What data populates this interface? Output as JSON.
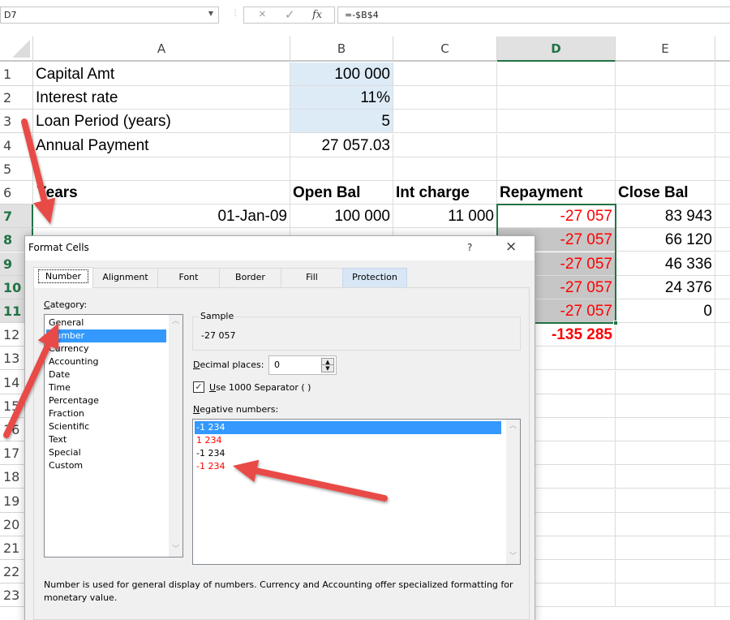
{
  "formula_bar": {
    "name_box": "D7",
    "cancel_icon": "×",
    "enter_icon": "✓",
    "fx_label": "fx",
    "formula": "=-$B$4"
  },
  "sheet": {
    "columns": [
      "A",
      "B",
      "C",
      "D",
      "E"
    ],
    "selected_column": "D",
    "row_numbers": [
      "1",
      "2",
      "3",
      "4",
      "5",
      "6",
      "7",
      "8",
      "9",
      "10",
      "11",
      "12",
      "13",
      "14",
      "15",
      "16",
      "17",
      "18",
      "19",
      "20",
      "21",
      "22",
      "23"
    ],
    "rows": [
      {
        "A": "Capital Amt",
        "B": "100 000"
      },
      {
        "A": "Interest rate",
        "B": "11%"
      },
      {
        "A": "Loan Period (years)",
        "B": "5"
      },
      {
        "A": "Annual Payment",
        "B": "27 057.03"
      },
      {},
      {
        "A": "Years",
        "B": "Open Bal",
        "C": "Int charge",
        "D": "Repayment",
        "E": "Close Bal"
      },
      {
        "A": "01-Jan-09",
        "B": "100 000",
        "C": "11 000",
        "D": "-27 057",
        "E": "83 943"
      },
      {
        "D": "-27 057",
        "E": "66 120"
      },
      {
        "D": "-27 057",
        "E": "46 336"
      },
      {
        "D": "-27 057",
        "E": "24 376"
      },
      {
        "D": "-27 057",
        "E": "0"
      },
      {
        "D": "-135 285"
      }
    ],
    "colors": {
      "negative": "#ff0000",
      "input_fill": "#ddebf7",
      "selection": "#217346"
    }
  },
  "dialog": {
    "title": "Format Cells",
    "help_label": "?",
    "close_label": "×",
    "tabs": [
      "Number",
      "Alignment",
      "Font",
      "Border",
      "Fill",
      "Protection"
    ],
    "active_tab": "Number",
    "category_label": "Category:",
    "categories": [
      "General",
      "Number",
      "Currency",
      "Accounting",
      "Date",
      "Time",
      "Percentage",
      "Fraction",
      "Scientific",
      "Text",
      "Special",
      "Custom"
    ],
    "selected_category": "Number",
    "sample_label": "Sample",
    "sample_value": "-27 057",
    "decimal_places_label": "Decimal places:",
    "decimal_places_value": "0",
    "use_separator_label": "Use 1000 Separator ( )",
    "use_separator_checked": true,
    "negative_numbers_label": "Negative numbers:",
    "negative_formats": [
      {
        "text": "-1 234",
        "color": "black",
        "selected": true
      },
      {
        "text": "1 234",
        "color": "red",
        "selected": false
      },
      {
        "text": "-1 234",
        "color": "black",
        "selected": false
      },
      {
        "text": "-1 234",
        "color": "red",
        "selected": false
      }
    ],
    "description": "Number is used for general display of numbers.  Currency and Accounting offer specialized formatting for monetary value."
  },
  "annotations": {
    "arrow_color": "#e84c47",
    "count": 3
  }
}
